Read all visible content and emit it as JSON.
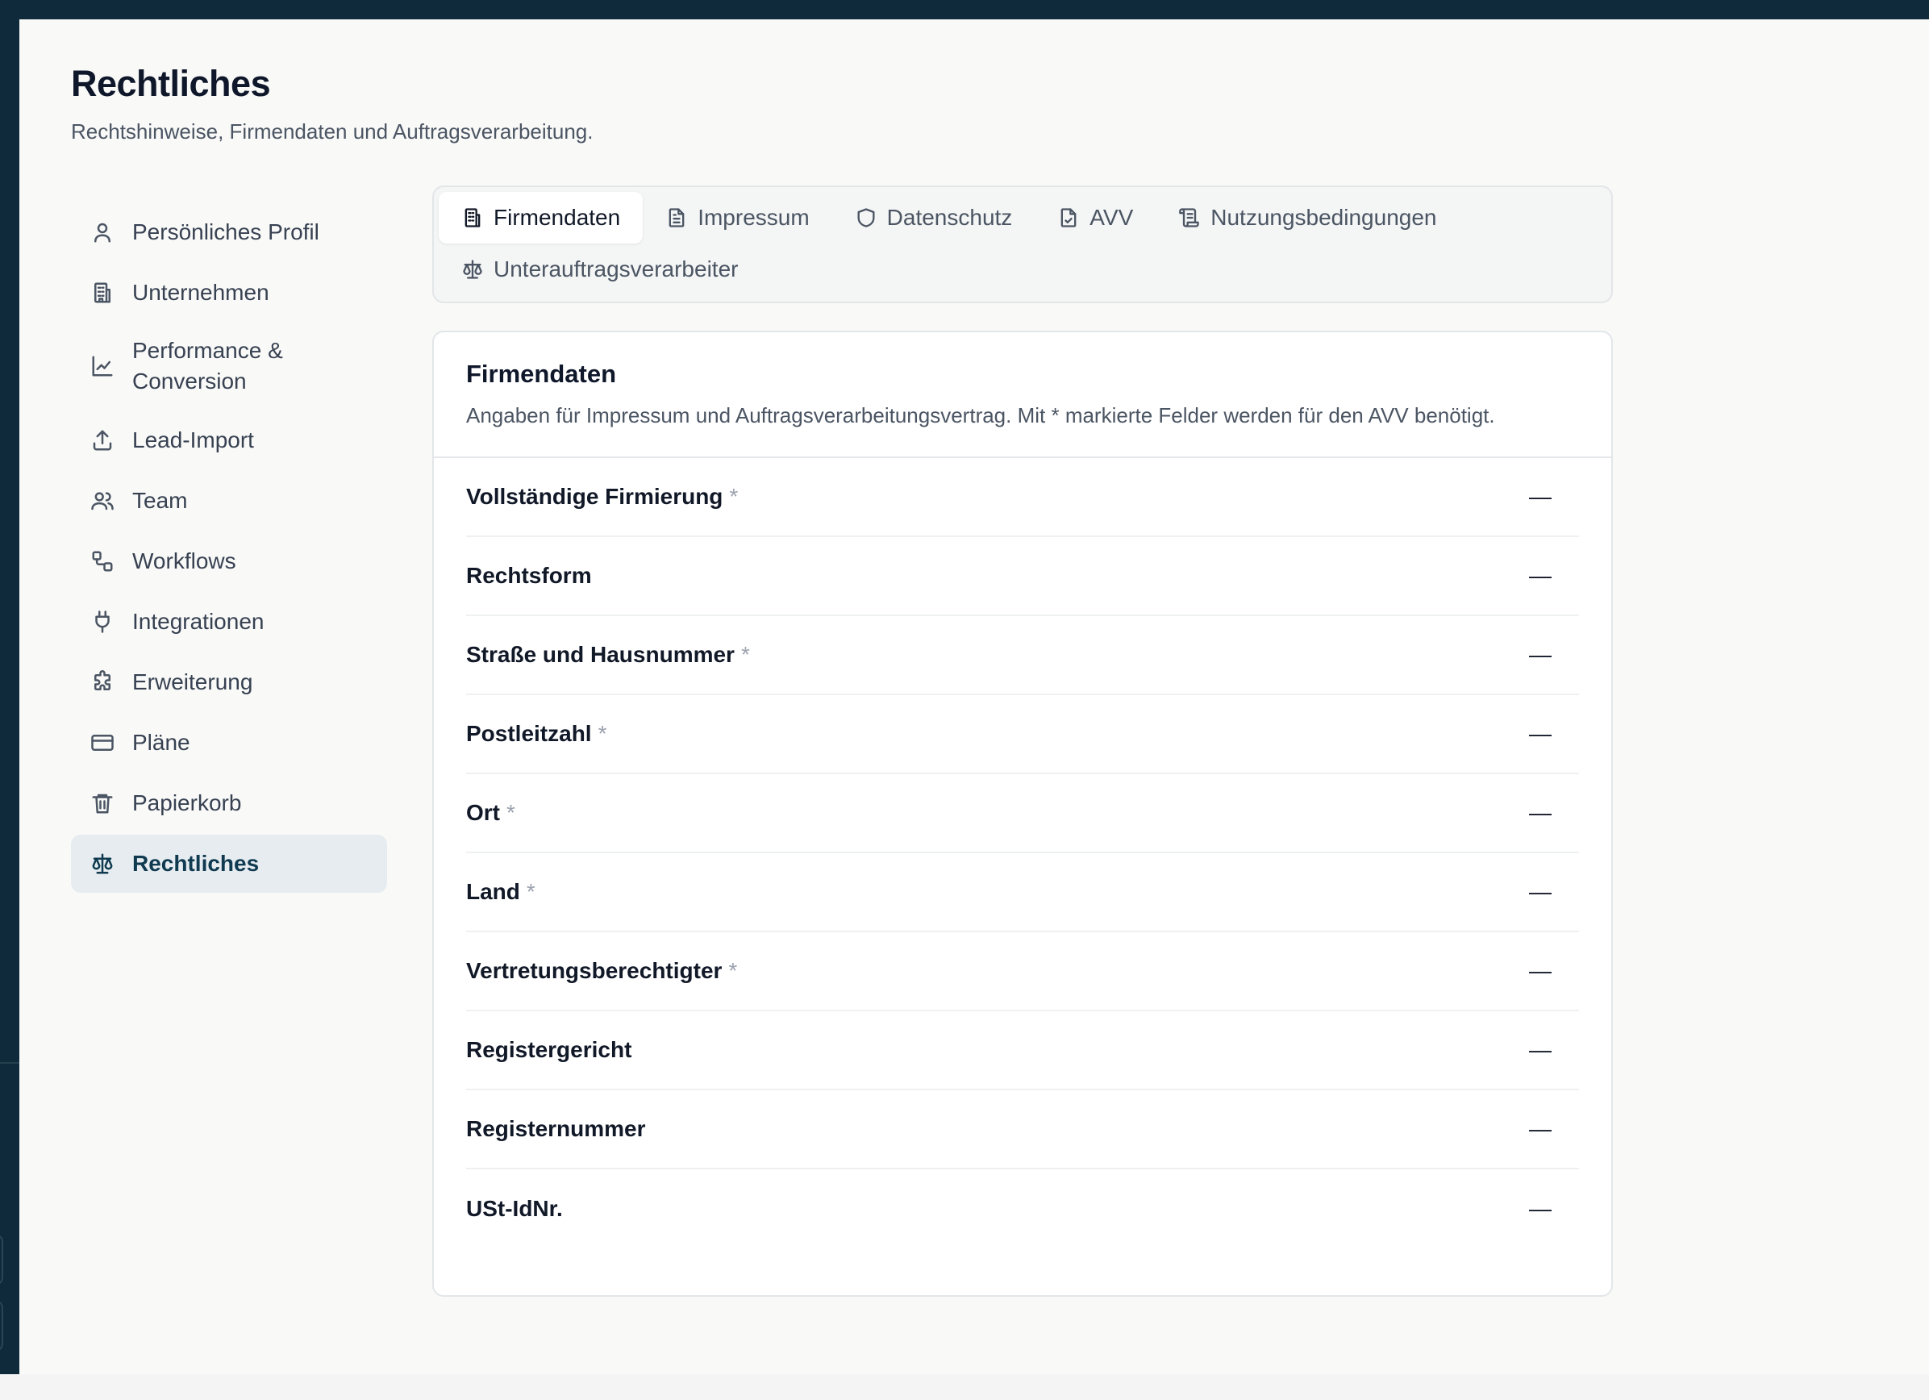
{
  "page": {
    "title": "Rechtliches",
    "subtitle": "Rechtshinweise, Firmendaten und Auftragsverarbeitung."
  },
  "sidebar": {
    "items": [
      {
        "label": "Persönliches Profil",
        "icon": "user-icon"
      },
      {
        "label": "Unternehmen",
        "icon": "building-icon"
      },
      {
        "label": "Performance & Conversion",
        "icon": "chart-line-icon"
      },
      {
        "label": "Lead-Import",
        "icon": "upload-icon"
      },
      {
        "label": "Team",
        "icon": "users-icon"
      },
      {
        "label": "Workflows",
        "icon": "workflow-icon"
      },
      {
        "label": "Integrationen",
        "icon": "plug-icon"
      },
      {
        "label": "Erweiterung",
        "icon": "puzzle-icon"
      },
      {
        "label": "Pläne",
        "icon": "credit-card-icon"
      },
      {
        "label": "Papierkorb",
        "icon": "trash-icon"
      },
      {
        "label": "Rechtliches",
        "icon": "scale-icon",
        "active": true
      }
    ]
  },
  "tabs": [
    {
      "label": "Firmendaten",
      "icon": "building-icon",
      "active": true
    },
    {
      "label": "Impressum",
      "icon": "document-icon"
    },
    {
      "label": "Datenschutz",
      "icon": "shield-icon"
    },
    {
      "label": "AVV",
      "icon": "file-check-icon"
    },
    {
      "label": "Nutzungsbedingungen",
      "icon": "scroll-icon"
    },
    {
      "label": "Unterauftragsverarbeiter",
      "icon": "scale-icon"
    }
  ],
  "card": {
    "title": "Firmendaten",
    "description": "Angaben für Impressum und Auftragsverarbeitungsvertrag. Mit * markierte Felder werden für den AVV benötigt.",
    "required_marker": "*",
    "fields": [
      {
        "label": "Vollständige Firmierung",
        "required": true,
        "value": "—"
      },
      {
        "label": "Rechtsform",
        "required": false,
        "value": "—"
      },
      {
        "label": "Straße und Hausnummer",
        "required": true,
        "value": "—"
      },
      {
        "label": "Postleitzahl",
        "required": true,
        "value": "—"
      },
      {
        "label": "Ort",
        "required": true,
        "value": "—"
      },
      {
        "label": "Land",
        "required": true,
        "value": "—"
      },
      {
        "label": "Vertretungsberechtigter",
        "required": true,
        "value": "—"
      },
      {
        "label": "Registergericht",
        "required": false,
        "value": "—"
      },
      {
        "label": "Registernummer",
        "required": false,
        "value": "—"
      },
      {
        "label": "USt-IdNr.",
        "required": false,
        "value": "—"
      }
    ]
  },
  "colors": {
    "chrome": "#0f2a3a",
    "page_bg": "#f9f9f8",
    "active_nav_bg": "#e6ecf0",
    "active_nav_text": "#0f3a50"
  }
}
